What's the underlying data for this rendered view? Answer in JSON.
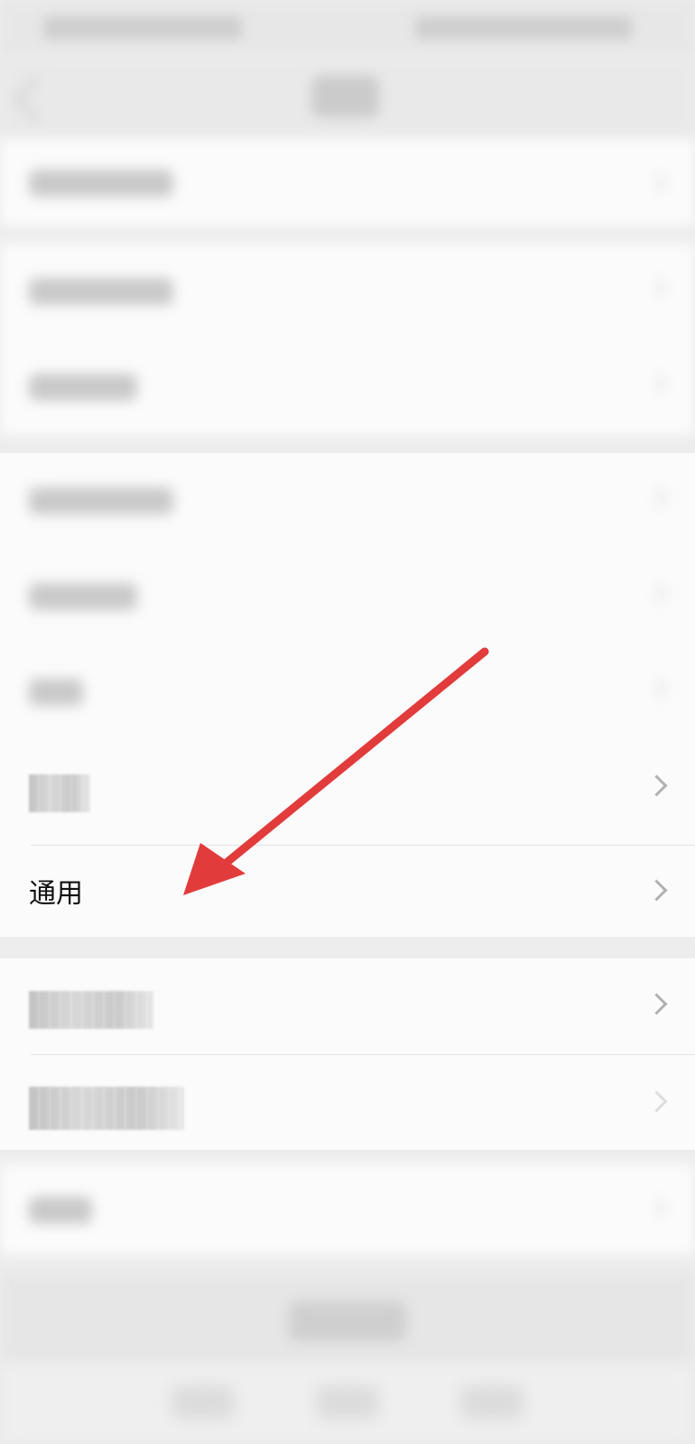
{
  "settings": {
    "items": {
      "general": {
        "label": "通用"
      }
    }
  },
  "colors": {
    "annotation_arrow": "#e23b3b",
    "row_background": "#fbfbfb",
    "page_background": "#ededed"
  },
  "icons": {
    "row_chevron": "chevron-right-icon",
    "annotation": "red-arrow-icon"
  }
}
